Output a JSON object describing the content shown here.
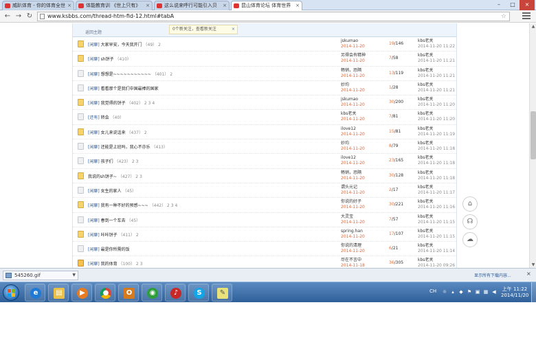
{
  "browser": {
    "tabs": [
      {
        "label": "威趴体育 - 你的体育全世"
      },
      {
        "label": "体能教育训 《世上只有》"
      },
      {
        "label": "这么说来呼行可能引入贝"
      },
      {
        "label": "昆山体育论坛 体育世界",
        "active": true
      }
    ],
    "url": "www.ksbbs.com/thread-htm-fid-12.html#tabA"
  },
  "page": {
    "home_link": "返回主题",
    "notice": {
      "text": "0个新关注，查看新关注",
      "close": "×"
    },
    "threads": [
      {
        "icon": "folder",
        "cat": "[闲聊]",
        "title": "大家早安，今天我开门",
        "pages": "（49）",
        "extra": "2",
        "author": "jskumao",
        "date": "2014-11-20",
        "replies": "19",
        "views": "146",
        "last_user": "kbs老关",
        "last_time": "2014-11-20 11:22"
      },
      {
        "icon": "folder",
        "cat": "[闲聊]",
        "title": "sh饼子",
        "pages": "（410）",
        "extra": "",
        "author": "另得会有精神",
        "date": "2014-11-20",
        "replies": "7",
        "views": "58",
        "last_user": "kbs老关",
        "last_time": "2014-11-20 11:21"
      },
      {
        "icon": "folder-plain",
        "cat": "[闲聊]",
        "title": "想想是~~~~~~~~~~~",
        "pages": "（401）",
        "extra": "2",
        "author": "畅销，恐隔",
        "date": "2014-11-20",
        "replies": "13",
        "views": "119",
        "last_user": "kbs老关",
        "last_time": "2014-11-20 11:21"
      },
      {
        "icon": "folder-plain",
        "cat": "[闲聊]",
        "title": "看看那个是我们中国最棒的国家",
        "pages": "",
        "extra": "",
        "author": "妙均",
        "date": "2014-11-20",
        "replies": "1",
        "views": "28",
        "last_user": "kbs老关",
        "last_time": "2014-11-20 11:21"
      },
      {
        "icon": "folder",
        "cat": "[闲聊]",
        "title": "我觉得的饼子",
        "pages": "（402）",
        "extra": "2 3 4",
        "author": "jskumao",
        "date": "2014-11-20",
        "replies": "30",
        "views": "200",
        "last_user": "kbs老关",
        "last_time": "2014-11-20 11:20"
      },
      {
        "icon": "folder-plain",
        "cat": "[还有]",
        "title": "转会",
        "pages": "（40）",
        "extra": "",
        "author": "kbs老关",
        "date": "2014-11-20",
        "replies": "7",
        "views": "81",
        "last_user": "kbs老关",
        "last_time": "2014-11-20 11:20"
      },
      {
        "icon": "folder",
        "cat": "[闲聊]",
        "title": "女儿来说话来",
        "pages": "（437）",
        "extra": "2",
        "author": "ilove12",
        "date": "2014-11-20",
        "replies": "15",
        "views": "81",
        "last_user": "kbs老关",
        "last_time": "2014-11-20 11:19"
      },
      {
        "icon": "folder-plain",
        "cat": "[闲聊]",
        "title": "还能是上班吗，我心不亦乐",
        "pages": "（413）",
        "extra": "",
        "author": "妙均",
        "date": "2014-11-20",
        "replies": "8",
        "views": "79",
        "last_user": "kbs老关",
        "last_time": "2014-11-20 11:18"
      },
      {
        "icon": "folder-plain",
        "cat": "[闲聊]",
        "title": "孩子们",
        "pages": "（423）",
        "extra": "2 3",
        "author": "ilove12",
        "date": "2014-11-20",
        "replies": "23",
        "views": "165",
        "last_user": "kbs老关",
        "last_time": "2014-11-20 11:18"
      },
      {
        "icon": "folder",
        "cat": "",
        "title": "我说的sh饼子~",
        "pages": "（427）",
        "extra": "2 3",
        "author": "畅销，恐隔",
        "date": "2014-11-20",
        "replies": "30",
        "views": "128",
        "last_user": "kbs老关",
        "last_time": "2014-11-20 11:18"
      },
      {
        "icon": "folder-plain",
        "cat": "[闲聊]",
        "title": "女生的家人",
        "pages": "（45）",
        "extra": "",
        "author": "谓头元记",
        "date": "2014-11-20",
        "replies": "2",
        "views": "17",
        "last_user": "kbs老关",
        "last_time": "2014-11-20 11:17"
      },
      {
        "icon": "folder",
        "cat": "[闲聊]",
        "title": "我有一种不好的预感~~~",
        "pages": "（442）",
        "extra": "2 3 4",
        "author": "你说的好子",
        "date": "2014-11-20",
        "replies": "30",
        "views": "221",
        "last_user": "kbs老关",
        "last_time": "2014-11-20 11:16"
      },
      {
        "icon": "folder-plain",
        "cat": "[闲聊]",
        "title": "春到一个车去",
        "pages": "（45）",
        "extra": "",
        "author": "大灵宝",
        "date": "2014-11-20",
        "replies": "7",
        "views": "57",
        "last_user": "kbs老关",
        "last_time": "2014-11-20 11:15"
      },
      {
        "icon": "folder",
        "cat": "[闲聊]",
        "title": "咔咔饼子",
        "pages": "（411）",
        "extra": "2",
        "author": "spring.han",
        "date": "2014-11-20",
        "replies": "17",
        "views": "107",
        "last_user": "kbs老关",
        "last_time": "2014-11-20 11:15"
      },
      {
        "icon": "folder-plain",
        "cat": "[闲聊]",
        "title": "最是你所需的饭",
        "pages": "",
        "extra": "",
        "author": "你说的清理",
        "date": "2014-11-20",
        "replies": "6",
        "views": "21",
        "last_user": "kbs老关",
        "last_time": "2014-11-20 11:14"
      },
      {
        "icon": "folder-hot",
        "cat": "[闲聊]",
        "title": "我的体育",
        "pages": "（100）",
        "extra": "2 3",
        "author": "尽在不言中",
        "date": "2014-11-18",
        "replies": "36",
        "views": "305",
        "last_user": "kbs老关",
        "last_time": "2014-11-20 09:26"
      }
    ]
  },
  "download": {
    "file": "545260.gif",
    "show_all": "显示所有下载内容..."
  },
  "taskbar": {
    "ime": "CH",
    "time": "上午 11:22",
    "date": "2014/11/20"
  },
  "colors": {
    "accent": "#2a5b9f",
    "date": "#d9683c",
    "taskbar": "#2f5f98"
  }
}
